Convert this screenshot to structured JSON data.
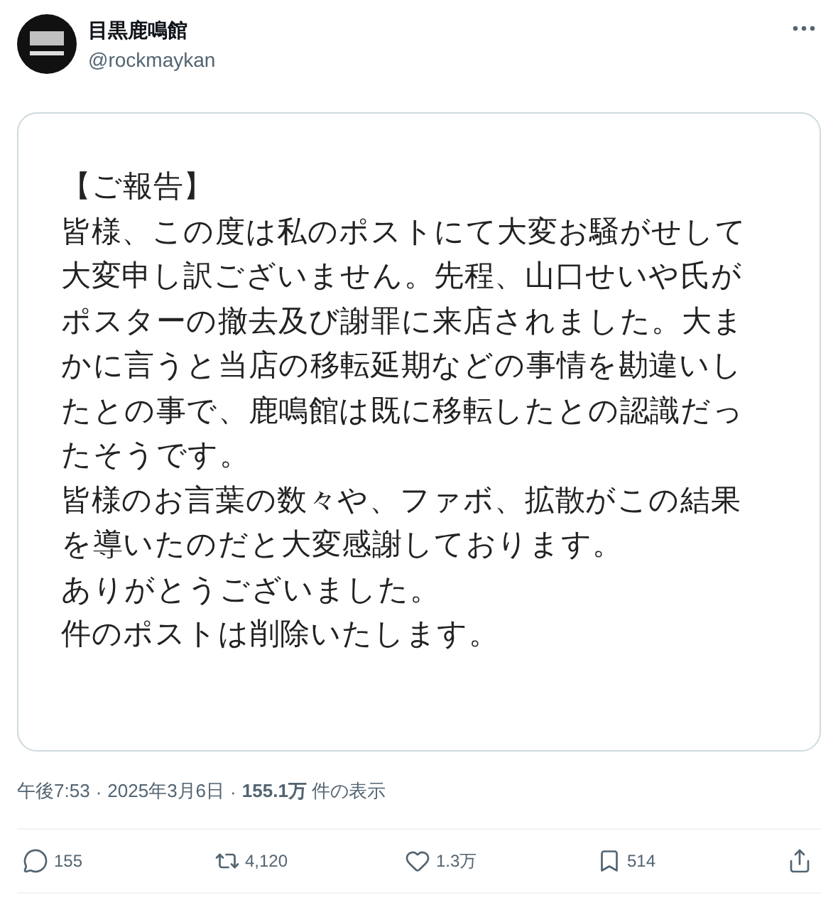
{
  "author": {
    "name": "目黒鹿鳴館",
    "handle": "@rockmaykan"
  },
  "image_text": {
    "lines": [
      "【ご報告】",
      "皆様、この度は私のポストにて大変お騒がせして",
      "大変申し訳ございません。先程、山口せいや氏が",
      "ポスターの撤去及び謝罪に来店されました。大ま",
      "かに言うと当店の移転延期などの事情を勘違いし",
      "たとの事で、鹿鳴館は既に移転したとの認識だっ",
      "たそうです。",
      "皆様のお言葉の数々や、ファボ、拡散がこの結果",
      "を導いたのだと大変感謝しております。",
      "ありがとうございました。",
      "件のポストは削除いたします。"
    ]
  },
  "meta": {
    "separator": "·",
    "time": "午後7:53",
    "date": "2025年3月6日",
    "views": "**155.1万** 件の表示"
  },
  "actions": [
    {
      "kind": "reply",
      "count": "155"
    },
    {
      "kind": "repost",
      "count": "4,120"
    },
    {
      "kind": "like",
      "count": "1.3万"
    },
    {
      "kind": "bookmark",
      "count": "514"
    },
    {
      "kind": "share"
    }
  ]
}
